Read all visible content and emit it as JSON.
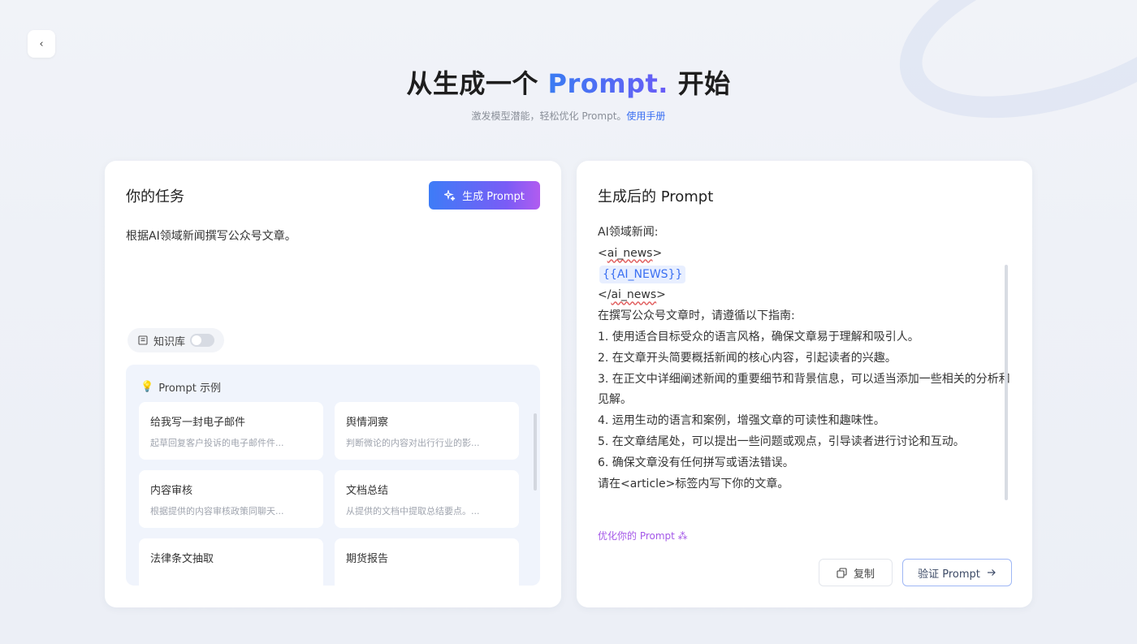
{
  "hero": {
    "title_prefix": "从生成一个 ",
    "title_accent": "Prompt.",
    "title_suffix": " 开始",
    "subtitle": "激发模型潜能，轻松优化 Prompt。",
    "manual_link": "使用手册"
  },
  "nav": {
    "back_icon": "chevron-left-icon",
    "back_glyph": "‹"
  },
  "task_panel": {
    "title": "你的任务",
    "generate_button": "生成 Prompt",
    "generate_icon": "sparkle-icon",
    "task_text": "根据AI领域新闻撰写公众号文章。",
    "knowledge_base_label": "知识库",
    "knowledge_base_enabled": false
  },
  "examples": {
    "heading": "Prompt 示例",
    "items": [
      {
        "title": "给我写一封电子邮件",
        "desc": "起草回复客户投诉的电子邮件件..."
      },
      {
        "title": "舆情洞察",
        "desc": "判断微论的内容对出行行业的影..."
      },
      {
        "title": "内容审核",
        "desc": "根据提供的内容审核政策同聊天..."
      },
      {
        "title": "文档总结",
        "desc": "从提供的文档中提取总结要点。..."
      },
      {
        "title": "法律条文抽取",
        "desc": ""
      },
      {
        "title": "期货报告",
        "desc": ""
      }
    ]
  },
  "output_panel": {
    "title": "生成后的 Prompt",
    "lines": {
      "l1": "AI领域新闻:",
      "l2_open": "<",
      "l2_tag": "ai_news",
      "l2_close": ">",
      "l3_var": "{{AI_NEWS}}",
      "l4_open": "</",
      "l4_tag": "ai_news",
      "l4_close": ">",
      "l5": "在撰写公众号文章时，请遵循以下指南:",
      "l6": "1. 使用适合目标受众的语言风格，确保文章易于理解和吸引人。",
      "l7": "2. 在文章开头简要概括新闻的核心内容，引起读者的兴趣。",
      "l8": "3. 在正文中详细阐述新闻的重要细节和背景信息，可以适当添加一些相关的分析和见解。",
      "l9": "4. 运用生动的语言和案例，增强文章的可读性和趣味性。",
      "l10": "5. 在文章结尾处，可以提出一些问题或观点，引导读者进行讨论和互动。",
      "l11": "6. 确保文章没有任何拼写或语法错误。",
      "l12": "请在<article>标签内写下你的文章。"
    },
    "optimize_link": "优化你的 Prompt ⁂",
    "copy_button": "复制",
    "verify_button": "验证 Prompt"
  }
}
